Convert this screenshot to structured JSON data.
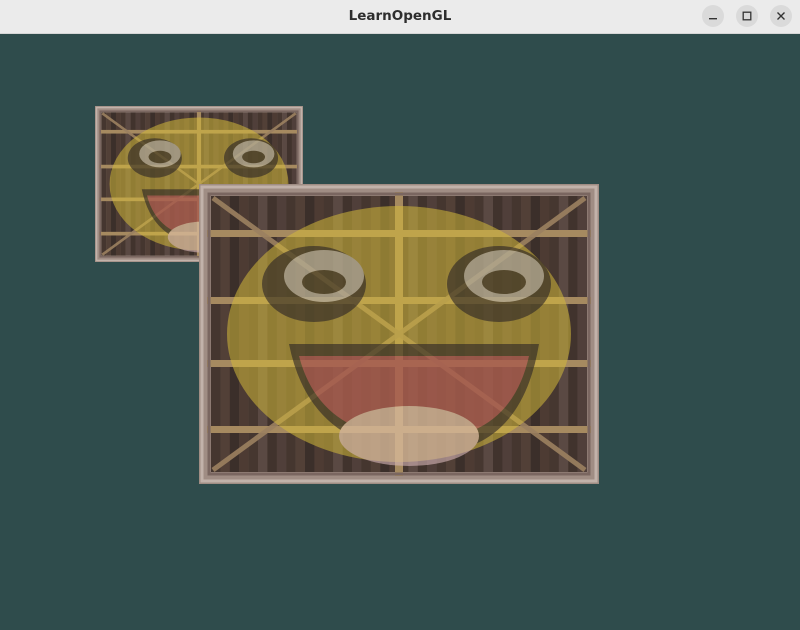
{
  "window": {
    "title": "LearnOpenGL",
    "controls": {
      "minimize_icon": "minimize-icon",
      "maximize_icon": "maximize-icon",
      "close_icon": "close-icon"
    }
  },
  "scene": {
    "clear_color": "#2f4c4c",
    "quads": [
      {
        "texture": "wooden-container",
        "overlay": "awesomeface"
      },
      {
        "texture": "wooden-container",
        "overlay": "awesomeface"
      }
    ]
  }
}
